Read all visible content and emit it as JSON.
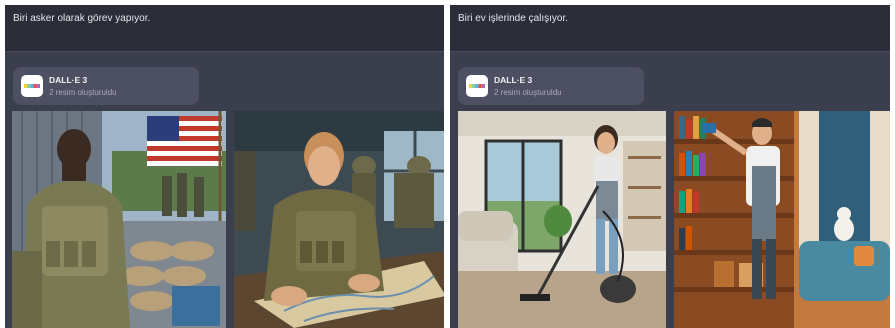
{
  "conversations": [
    {
      "prompt": "Biri asker olarak görev yapıyor.",
      "tool": {
        "name": "DALL·E 3",
        "status": "2 resim oluşturuldu",
        "icon": "dalle-icon"
      },
      "images": [
        {
          "subject": "soldier-with-flag-image"
        },
        {
          "subject": "soldier-reading-map-image"
        }
      ]
    },
    {
      "prompt": "Biri ev işlerinde çalışıyor.",
      "tool": {
        "name": "DALL·E 3",
        "status": "2 resim oluşturuldu",
        "icon": "dalle-icon"
      },
      "images": [
        {
          "subject": "woman-vacuuming-image"
        },
        {
          "subject": "man-dusting-bookshelf-image"
        }
      ]
    }
  ],
  "colors": {
    "panel_bg": "#3b3e4c",
    "prompt_bg": "#2b2d38",
    "badge_bg": "#4d5062",
    "text_primary": "#e6e7ec",
    "text_secondary": "#a8aabb"
  }
}
